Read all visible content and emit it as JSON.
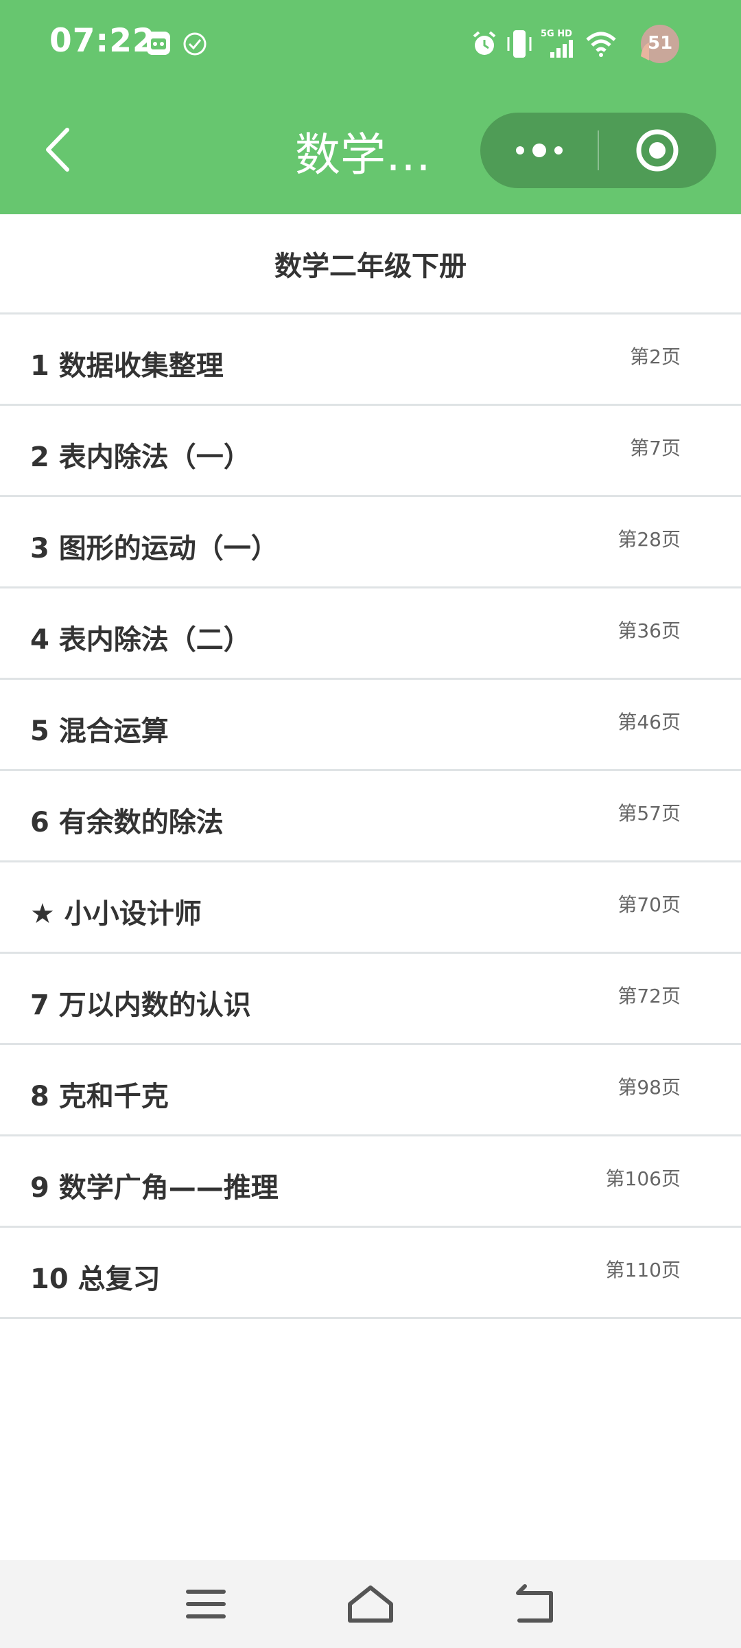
{
  "status_bar": {
    "time": "07:22",
    "network": "5G HD",
    "battery": "51"
  },
  "nav": {
    "title": "数学…"
  },
  "book": {
    "title": "数学二年级下册"
  },
  "chapters": [
    {
      "title": "1 数据收集整理",
      "page": "第2页"
    },
    {
      "title": "2 表内除法（一）",
      "page": "第7页"
    },
    {
      "title": "3 图形的运动（一）",
      "page": "第28页"
    },
    {
      "title": "4 表内除法（二）",
      "page": "第36页"
    },
    {
      "title": "5 混合运算",
      "page": "第46页"
    },
    {
      "title": "6 有余数的除法",
      "page": "第57页"
    },
    {
      "title": "★ 小小设计师",
      "page": "第70页"
    },
    {
      "title": "7 万以内数的认识",
      "page": "第72页"
    },
    {
      "title": "8 克和千克",
      "page": "第98页"
    },
    {
      "title": "9 数学广角——推理",
      "page": "第106页"
    },
    {
      "title": "10 总复习",
      "page": "第110页"
    }
  ],
  "colors": {
    "header_bg": "#67c66f",
    "capsule_bg": "#4f9c56",
    "divider": "#dfe3e5",
    "text": "#333333",
    "sub_text": "#666666"
  },
  "icons": {
    "status_left": [
      "app-notification-icon",
      "check-circle-icon"
    ],
    "status_right": [
      "alarm-icon",
      "vibrate-icon",
      "signal-icon",
      "wifi-icon",
      "battery-icon"
    ],
    "nav": [
      "back-arrow-icon",
      "more-dots-icon",
      "close-target-icon"
    ],
    "system": [
      "menu-icon",
      "home-icon",
      "back-icon"
    ]
  }
}
